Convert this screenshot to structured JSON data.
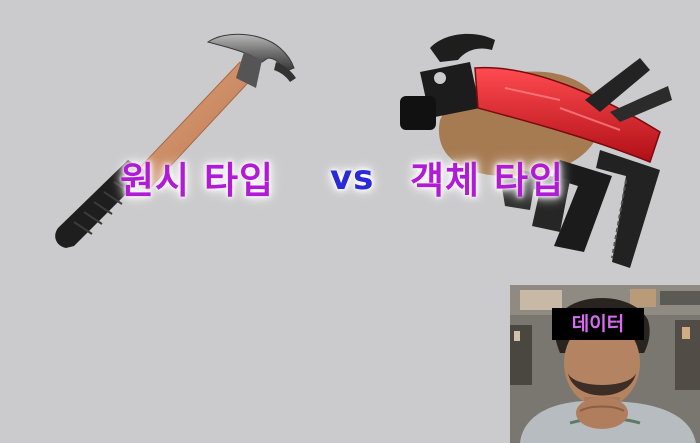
{
  "title": {
    "left": "원시 타입",
    "vs": "vs",
    "right": "객체 타입"
  },
  "webcam": {
    "label": "데이터"
  },
  "colors": {
    "background": "#cbcbcd",
    "title_purple": "#b21bd6",
    "vs_blue": "#2a2ad6",
    "webcam_label_text": "#d86cf0",
    "webcam_label_bg": "#000000",
    "hammer_handle": "#c9825a",
    "multitool_red": "#d61d25"
  },
  "images": {
    "left": "claw-hammer",
    "right": "multi-tool-hammer",
    "overlay": "presenter-webcam"
  }
}
